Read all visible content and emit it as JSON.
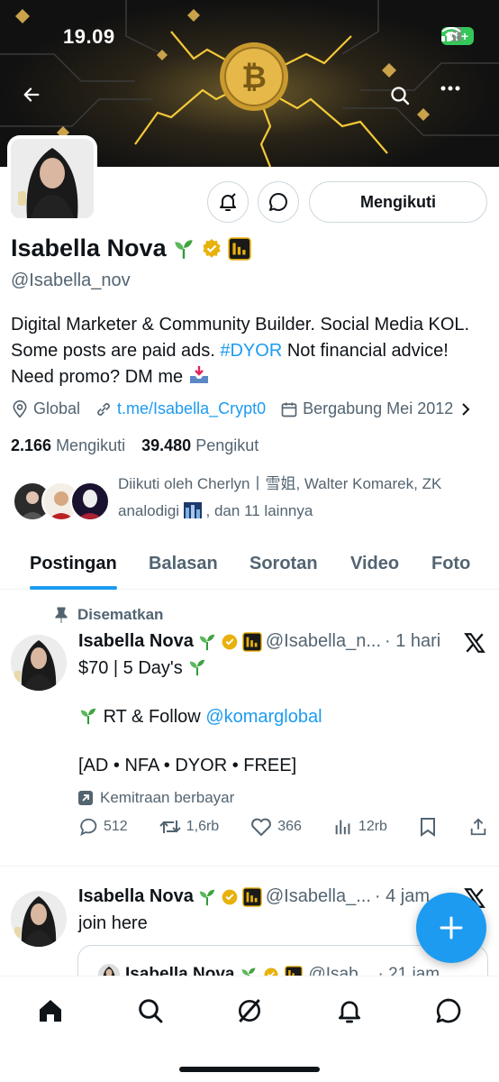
{
  "status_bar": {
    "time": "19.09",
    "battery": "76+"
  },
  "profile": {
    "name": "Isabella Nova",
    "handle": "@Isabella_nov",
    "bio_pre": "Digital Marketer & Community Builder. Social Media KOL. Some posts are paid ads. ",
    "bio_tag": "#DYOR",
    "bio_post": " Not financial advice! Need promo? DM me",
    "location": "Global",
    "website": "t.me/Isabella_Crypt0",
    "joined": "Bergabung Mei 2012",
    "following_count": "2.166",
    "following_label": "Mengikuti",
    "followers_count": "39.480",
    "followers_label": "Pengikut",
    "followed_by_text": "Diikuti oleh Cherlyn丨雪姐, Walter Komarek, ZK analodigi",
    "followed_by_more": ", dan 11 lainnya",
    "follow_button": "Mengikuti"
  },
  "tabs": [
    "Postingan",
    "Balasan",
    "Sorotan",
    "Video",
    "Foto"
  ],
  "posts": [
    {
      "pinned_label": "Disematkan",
      "author": "Isabella Nova",
      "handle": "@Isabella_n...",
      "time": "· 1 hari",
      "line1": "$70 | 5 Day's",
      "line2": "RT & Follow",
      "mention": "@komarglobal",
      "line3": "[AD • NFA • DYOR • FREE]",
      "partner": "Kemitraan berbayar",
      "replies": "512",
      "reposts": "1,6rb",
      "likes": "366",
      "views": "12rb"
    },
    {
      "author": "Isabella Nova",
      "handle": "@Isabella_...",
      "time": "· 4 jam",
      "text": "join here",
      "quote_author": "Isabella Nova",
      "quote_handle": "@Isab...",
      "quote_time": "· 21 jam"
    }
  ],
  "colors": {
    "accent": "#1d9bf0",
    "text": "#0f1419",
    "muted": "#536471",
    "verified": "#e8b10c"
  }
}
